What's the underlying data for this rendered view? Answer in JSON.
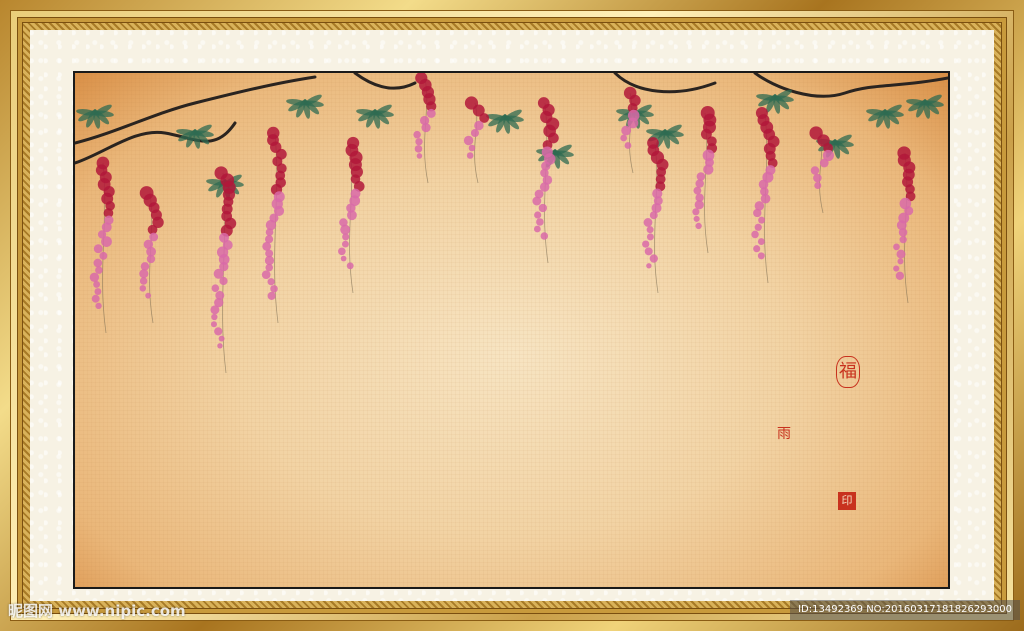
{
  "image": {
    "subject": "wisteria",
    "palette": {
      "frame_gold": "#d4a94a",
      "mat": "#f7f2e4",
      "paper": "#f2d3a4",
      "paper_edge": "#d98f46",
      "blossom_dark": "#b2183a",
      "blossom_light": "#d96aa8",
      "leaf": "#2f6b52",
      "branch": "#2a2420",
      "seal_red": "#c8321e"
    }
  },
  "seals": {
    "fu": "福",
    "round": "雨",
    "square": "印"
  },
  "watermark": {
    "left": "昵图网 www.nipic.com",
    "right": "ID:13492369 NO:20160317181826293000"
  }
}
